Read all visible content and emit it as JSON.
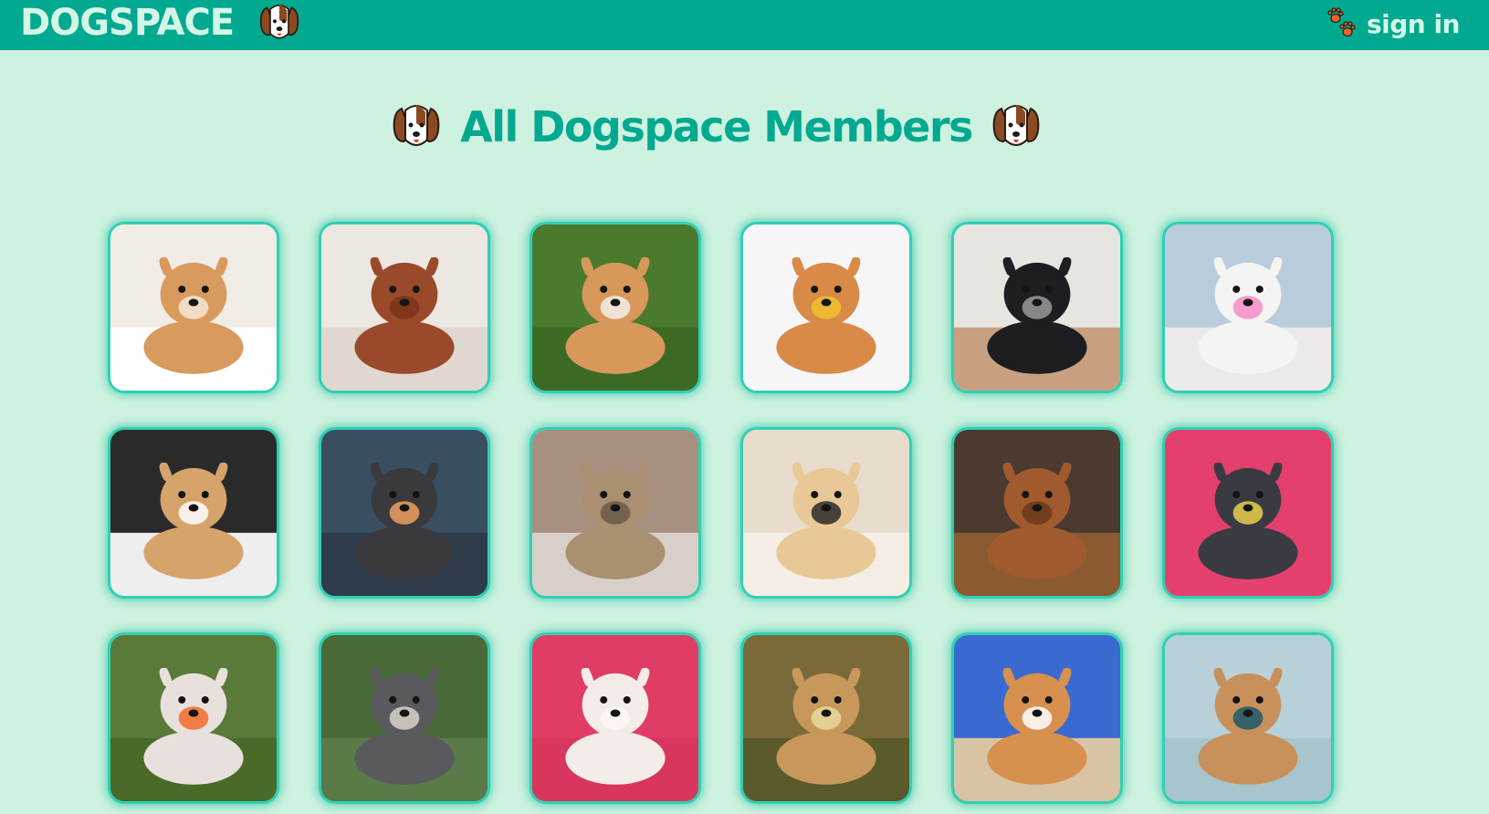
{
  "app": {
    "logo_text": "DOGSPACE",
    "sign_in_label": "sign in"
  },
  "page": {
    "title": "All Dogspace Members"
  },
  "colors": {
    "topbar": "#00a98f",
    "background": "#cdf2e0",
    "title": "#00a98f",
    "tile_border": "#2fd0b4"
  },
  "members": [
    {
      "photo": "shiba-on-fluffy-rug",
      "bg": "#f2ece6",
      "floor": "#ffffff",
      "dog": "#d99a5e",
      "accent": "#f5e8d8"
    },
    {
      "photo": "brown-mastiff",
      "bg": "#ede7e2",
      "floor": "#e0d8d0",
      "dog": "#9a4a2a",
      "accent": "#7a3218"
    },
    {
      "photo": "puppy-on-grass",
      "bg": "#4a7a2e",
      "floor": "#3c6a24",
      "dog": "#d8985a",
      "accent": "#f4f0ea"
    },
    {
      "photo": "shiba-with-yellow-beanie",
      "bg": "#f6f6f8",
      "floor": "#f6f6f8",
      "dog": "#d88a46",
      "accent": "#f2c030"
    },
    {
      "photo": "pug-with-glasses",
      "bg": "#e8e4e0",
      "floor": "#c8a080",
      "dog": "#1e1e22",
      "accent": "#9a9a9a"
    },
    {
      "photo": "white-dog-pink-glasses",
      "bg": "#b8ccdc",
      "floor": "#ecebe8",
      "dog": "#f4f4f2",
      "accent": "#f58bc8"
    },
    {
      "photo": "chow-with-sunglasses",
      "bg": "#2a2a2a",
      "floor": "#eeeeee",
      "dog": "#d6a46a",
      "accent": "#ffffff"
    },
    {
      "photo": "husky-in-snow",
      "bg": "#3a4e62",
      "floor": "#2e3c4c",
      "dog": "#3a3a3e",
      "accent": "#f0a060"
    },
    {
      "photo": "fluffy-terrier",
      "bg": "#a89080",
      "floor": "#d8d0c8",
      "dog": "#a89070",
      "accent": "#6a5a48"
    },
    {
      "photo": "labrador-with-glasses",
      "bg": "#e8dccc",
      "floor": "#f4eee4",
      "dog": "#e8c896",
      "accent": "#2a2a2a"
    },
    {
      "photo": "poodle-mix-on-sand",
      "bg": "#4a3a30",
      "floor": "#8a5a30",
      "dog": "#a05a2e",
      "accent": "#6a3a1a"
    },
    {
      "photo": "chihuahua-with-bowtie",
      "bg": "#e4406e",
      "floor": "#e4406e",
      "dog": "#3a3a42",
      "accent": "#e8d04a"
    },
    {
      "photo": "aussie-with-ball",
      "bg": "#5a7a3a",
      "floor": "#4a6a2a",
      "dog": "#e8e0dc",
      "accent": "#f26a2a"
    },
    {
      "photo": "schnauzer-portrait",
      "bg": "#4a6a3a",
      "floor": "#5a7a48",
      "dog": "#5a5a5e",
      "accent": "#d8d2ca"
    },
    {
      "photo": "white-poodle",
      "bg": "#e03c64",
      "floor": "#d8365c",
      "dog": "#f4ece8",
      "accent": "#fff6f2"
    },
    {
      "photo": "yorkie-in-flowers",
      "bg": "#7a6a3a",
      "floor": "#5a5a2a",
      "dog": "#c8985a",
      "accent": "#e8d8a0"
    },
    {
      "photo": "corgi-on-beach",
      "bg": "#3a6ad0",
      "floor": "#d8c4a4",
      "dog": "#d8904e",
      "accent": "#ffffff"
    },
    {
      "photo": "saluki-portrait",
      "bg": "#b8d0d8",
      "floor": "#a8c4cc",
      "dog": "#c8905a",
      "accent": "#1a5a6a"
    }
  ]
}
